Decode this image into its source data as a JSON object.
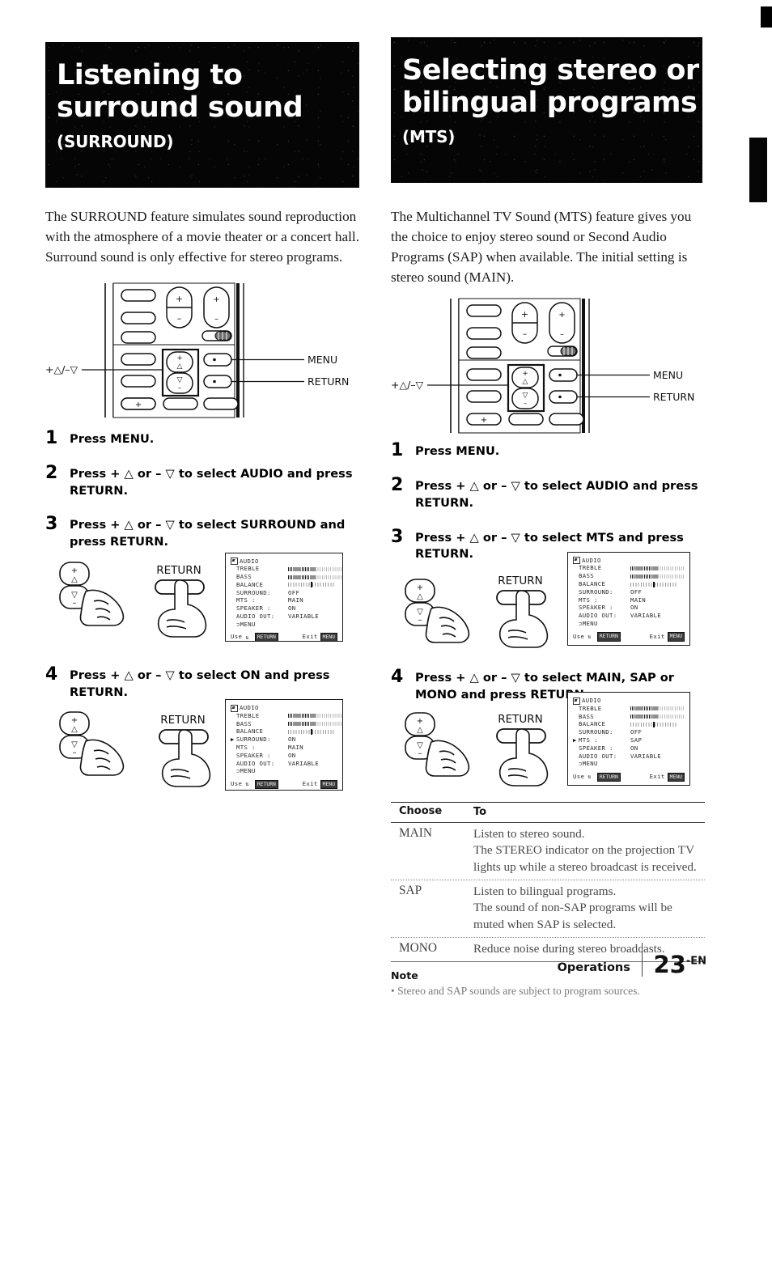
{
  "page": {
    "footer_section": "Operations",
    "page_number": "23",
    "page_lang_suffix": "-EN"
  },
  "left_column": {
    "banner": {
      "title_line1": "Listening to",
      "title_line2": "surround sound",
      "subtitle": "(SURROUND)"
    },
    "intro": "The SURROUND feature simulates sound reproduction with the atmosphere of a movie theater or a concert hall.  Surround sound is only effective for stereo programs.",
    "remote": {
      "label_updown": "+△/–▽",
      "label_menu": "MENU",
      "label_return": "RETURN"
    },
    "steps": [
      {
        "num": "1",
        "text": "Press MENU."
      },
      {
        "num": "2",
        "text": "Press + △ or – ▽ to select AUDIO and press RETURN."
      },
      {
        "num": "3",
        "text": "Press + △ or – ▽ to select SURROUND and press RETURN."
      },
      {
        "num": "4",
        "text": "Press + △ or – ▽ to select ON and press RETURN."
      }
    ],
    "illus_return_label": "RETURN",
    "osd_step3": {
      "title": "AUDIO",
      "rows": [
        {
          "ptr": "",
          "key": "TREBLE",
          "val": "",
          "bar": "on"
        },
        {
          "ptr": "",
          "key": "BASS",
          "val": "",
          "bar": "on"
        },
        {
          "ptr": "",
          "key": "BALANCE",
          "val": "",
          "bar": "center"
        },
        {
          "ptr": "",
          "key": "SURROUND:",
          "val": "OFF",
          "bar": ""
        },
        {
          "ptr": "",
          "key": "MTS :",
          "val": "MAIN",
          "bar": ""
        },
        {
          "ptr": "",
          "key": "SPEAKER :",
          "val": "ON",
          "bar": ""
        },
        {
          "ptr": "",
          "key": "AUDIO OUT:",
          "val": "VARIABLE",
          "bar": ""
        },
        {
          "ptr": "",
          "key": "⊃MENU",
          "val": "",
          "bar": ""
        }
      ],
      "foot_use": "Use",
      "foot_use_chip": "RETURN",
      "foot_exit": "Exit",
      "foot_exit_chip": "MENU"
    },
    "osd_step4": {
      "title": "AUDIO",
      "rows": [
        {
          "ptr": "",
          "key": "TREBLE",
          "val": "",
          "bar": "on"
        },
        {
          "ptr": "",
          "key": "BASS",
          "val": "",
          "bar": "on"
        },
        {
          "ptr": "",
          "key": "BALANCE",
          "val": "",
          "bar": "center"
        },
        {
          "ptr": "▶",
          "key": "SURROUND:",
          "val": "ON",
          "bar": ""
        },
        {
          "ptr": "",
          "key": "MTS :",
          "val": "MAIN",
          "bar": ""
        },
        {
          "ptr": "",
          "key": "SPEAKER :",
          "val": "ON",
          "bar": ""
        },
        {
          "ptr": "",
          "key": "AUDIO OUT:",
          "val": "VARIABLE",
          "bar": ""
        },
        {
          "ptr": "",
          "key": "⊃MENU",
          "val": "",
          "bar": ""
        }
      ],
      "foot_use": "Use",
      "foot_use_chip": "RETURN",
      "foot_exit": "Exit",
      "foot_exit_chip": "MENU"
    }
  },
  "right_column": {
    "banner": {
      "title_line1": "Selecting stereo or",
      "title_line2": "bilingual programs",
      "subtitle": "(MTS)"
    },
    "intro": "The Multichannel TV Sound (MTS) feature gives you the choice to enjoy stereo sound or Second Audio Programs (SAP) when available.  The initial setting is stereo sound (MAIN).",
    "remote": {
      "label_updown": "+△/–▽",
      "label_menu": "MENU",
      "label_return": "RETURN"
    },
    "steps": [
      {
        "num": "1",
        "text": "Press MENU."
      },
      {
        "num": "2",
        "text": "Press + △ or – ▽ to select AUDIO and press RETURN."
      },
      {
        "num": "3",
        "text": "Press + △ or – ▽ to select MTS and press RETURN."
      },
      {
        "num": "4",
        "text": "Press + △ or – ▽ to select MAIN, SAP or MONO and press RETURN."
      }
    ],
    "illus_return_label": "RETURN",
    "osd_step3": {
      "title": "AUDIO",
      "rows": [
        {
          "ptr": "",
          "key": "TREBLE",
          "val": "",
          "bar": "on"
        },
        {
          "ptr": "",
          "key": "BASS",
          "val": "",
          "bar": "on"
        },
        {
          "ptr": "",
          "key": "BALANCE",
          "val": "",
          "bar": "center"
        },
        {
          "ptr": "",
          "key": "SURROUND:",
          "val": "OFF",
          "bar": ""
        },
        {
          "ptr": "",
          "key": "MTS :",
          "val": "MAIN",
          "bar": ""
        },
        {
          "ptr": "",
          "key": "SPEAKER :",
          "val": "ON",
          "bar": ""
        },
        {
          "ptr": "",
          "key": "AUDIO OUT:",
          "val": "VARIABLE",
          "bar": ""
        },
        {
          "ptr": "",
          "key": "⊃MENU",
          "val": "",
          "bar": ""
        }
      ],
      "foot_use": "Use",
      "foot_use_chip": "RETURN",
      "foot_exit": "Exit",
      "foot_exit_chip": "MENU"
    },
    "osd_step4": {
      "title": "AUDIO",
      "rows": [
        {
          "ptr": "",
          "key": "TREBLE",
          "val": "",
          "bar": "on"
        },
        {
          "ptr": "",
          "key": "BASS",
          "val": "",
          "bar": "on"
        },
        {
          "ptr": "",
          "key": "BALANCE",
          "val": "",
          "bar": "center"
        },
        {
          "ptr": "",
          "key": "SURROUND:",
          "val": "OFF",
          "bar": ""
        },
        {
          "ptr": "▶",
          "key": "MTS :",
          "val": "SAP",
          "bar": ""
        },
        {
          "ptr": "",
          "key": "SPEAKER :",
          "val": "ON",
          "bar": ""
        },
        {
          "ptr": "",
          "key": "AUDIO OUT:",
          "val": "VARIABLE",
          "bar": ""
        },
        {
          "ptr": "",
          "key": "⊃MENU",
          "val": "",
          "bar": ""
        }
      ],
      "foot_use": "Use",
      "foot_use_chip": "RETURN",
      "foot_exit": "Exit",
      "foot_exit_chip": "MENU"
    },
    "choose_table": {
      "col1_header": "Choose",
      "col2_header": "To",
      "rows": [
        {
          "choose": "MAIN",
          "to": "Listen to stereo sound.\nThe STEREO indicator on the projection TV lights up while a stereo broadcast is received."
        },
        {
          "choose": "SAP",
          "to": "Listen to bilingual programs.\nThe sound of non-SAP programs will be muted when SAP is selected."
        },
        {
          "choose": "MONO",
          "to": "Reduce noise during stereo broadcasts."
        }
      ]
    },
    "note": {
      "heading": "Note",
      "bullet": "• Stereo and SAP sounds are subject to program sources."
    }
  }
}
